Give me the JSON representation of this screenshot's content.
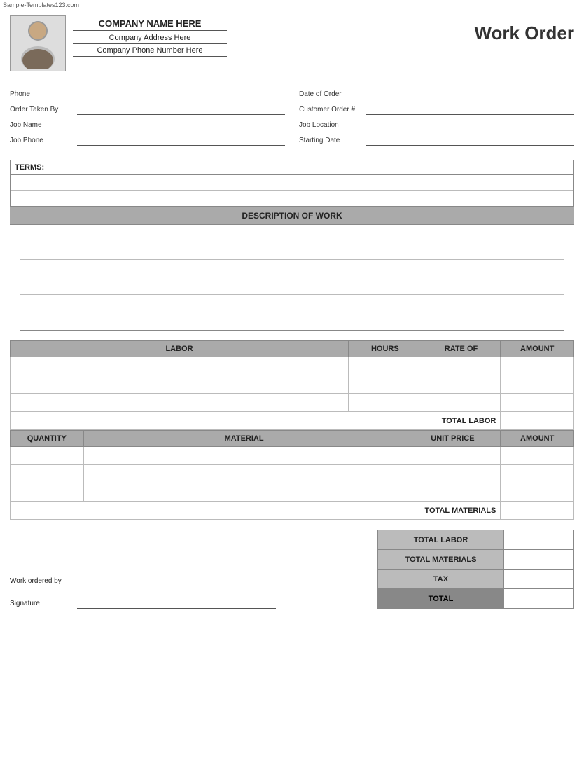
{
  "watermark": "Sample-Templates123.com",
  "header": {
    "company_name": "COMPANY NAME HERE",
    "company_address": "Company Address Here",
    "company_phone": "Company Phone Number Here",
    "title": "Work Order"
  },
  "form": {
    "left": [
      {
        "label": "Phone",
        "name": "phone"
      },
      {
        "label": "Order Taken By",
        "name": "order-taken-by"
      },
      {
        "label": "Job Name",
        "name": "job-name"
      },
      {
        "label": "Job Phone",
        "name": "job-phone"
      }
    ],
    "right": [
      {
        "label": "Date of Order",
        "name": "date-of-order"
      },
      {
        "label": "Customer Order #",
        "name": "customer-order"
      },
      {
        "label": "Job Location",
        "name": "job-location"
      },
      {
        "label": "Starting Date",
        "name": "starting-date"
      }
    ]
  },
  "terms": {
    "label": "TERMS:"
  },
  "description": {
    "header": "DESCRIPTION OF WORK",
    "rows": 6
  },
  "labor": {
    "columns": [
      "LABOR",
      "HOURS",
      "RATE OF",
      "AMOUNT"
    ],
    "rows": 3,
    "total_label": "TOTAL LABOR"
  },
  "materials": {
    "columns": [
      "QUANTITY",
      "MATERIAL",
      "UNIT PRICE",
      "AMOUNT"
    ],
    "rows": 3,
    "total_label": "TOTAL MATERIALS"
  },
  "summary": {
    "work_ordered_by_label": "Work ordered by",
    "signature_label": "Signature",
    "totals": [
      {
        "label": "TOTAL LABOR"
      },
      {
        "label": "TOTAL MATERIALS"
      },
      {
        "label": "TAX"
      },
      {
        "label": "TOTAL"
      }
    ]
  }
}
